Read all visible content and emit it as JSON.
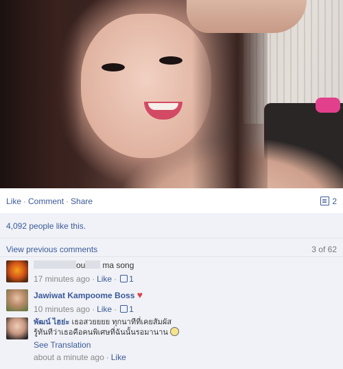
{
  "actions": {
    "like": "Like",
    "comment": "Comment",
    "share": "Share",
    "share_count": "2",
    "separator": "·"
  },
  "likes_text": "4,092 people like this.",
  "view_previous": "View previous comments",
  "comment_count": "3 of 62",
  "comments": [
    {
      "text_visible_1": "ou",
      "text_visible_2": "ma song",
      "time": "17 minutes ago",
      "like": "Like",
      "like_count": "1"
    },
    {
      "author": "Jawiwat Kampoome Boss",
      "time": "10 minutes ago",
      "like": "Like",
      "like_count": "1",
      "emoji": "heart"
    },
    {
      "author": "พัฒน์ ไฮย่ะ",
      "text_line1": "เธอสวยยยย ทุกนาทีที่เคยสัมผัส",
      "text_line2": "รู้ทันทีว่าเธอคือคนพิเศษที่ฉันนั้นรอมานาน",
      "see_translation": "See Translation",
      "time": "about a minute ago",
      "like": "Like"
    }
  ],
  "colors": {
    "link": "#3b5998",
    "panel_bg": "#f0f2f7",
    "meta_text": "#888888"
  }
}
